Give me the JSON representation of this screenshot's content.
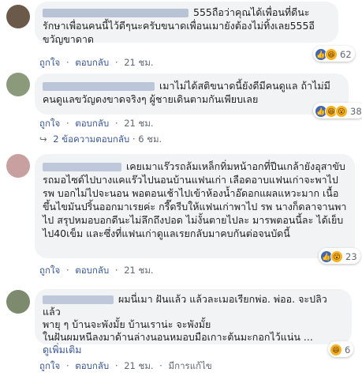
{
  "comments": [
    {
      "text_tail": "555ถือว่าคุณได้เพื่อนที่ดีนะรักษาเพื่อนคนนี้ไว้ดีๆนะครับขนาดเพื่อนเมายังต้องไม่ทิ้งเลย555อีขวัญขาดาด",
      "like_label": "ถูกใจ",
      "reply_label": "ตอบกลับ",
      "time": "21 ชม.",
      "reaction_count": "62"
    },
    {
      "text_tail": "เมาไม่ได้สติขนาดนี้ยังดีมีคนดูแล ถ้าไม่มีคนดูแลขวัญดงขาดจริงๆ ผู้ชายเดินตามกันเพียบเลย",
      "like_label": "ถูกใจ",
      "reply_label": "ตอบกลับ",
      "time": "21 ชม.",
      "reaction_count": "38"
    },
    {
      "text_tail": "เคยเมาแร๊วรถล้มเหล็กทิ่มหน้าอกที่ปีนเกล้ายังอุสาขับรถมอไซด์ไปบางแคแร๊วไปนอนบ้านแฟนเก่า เลือดอาบแฟนเก่าจะพาไปรพ บอกไม่ไปจะนอน พอตอนเช้าไปเข้าห้องน้ำอ๊ดอกแผลแหวะมาก เนื้อขึ้นไขมันปริ้นออกมาเรยค่ะ กรี๊ดรีบให้แฟนเก่าพาไป รพ นางก็ดลาจานพาไป สรุปหมอบอกดีนะไม่ลึกถึงปอด ไม่งั้นตายไปละ มารพตอนนี้ละ ได้เย็บไป40เข็ม และซึ่งที่แฟนเก่าดูแลเรยกลับมาคบกันต่อจนบัดนี้",
      "like_label": "ถูกใจ",
      "reply_label": "ตอบกลับ",
      "time": "21 ชม.",
      "reaction_count": "23"
    },
    {
      "text_tail": "ผมนี่เมา ฝันแล้ว แล้วละเมอเรียกพ่อ. พ่ออ. จะปลิวแล้ว",
      "line2": "พายุ ๆ บ้านจะพังมั้ย บ้านเราน่ะ จะพังมั้ย",
      "line3": "ในฝันผมหนีลงมาด้านล่างนอนหมอบมือเกาะต้นมะกอกไว้แน่น ...",
      "see_more": "ดูเพิ่มเติม",
      "like_label": "ถูกใจ",
      "reply_label": "ตอบกลับ",
      "time": "21 ชม.",
      "edited": "มีการแก้ไข",
      "reaction_count": "6"
    }
  ],
  "replies_link": {
    "label": "2 ข้อความตอบกลับ",
    "time": "6 ชม."
  },
  "colors": {
    "bubble": "#f2f3f5",
    "link": "#385898",
    "meta": "#606770",
    "like": "#4267b2",
    "haha": "#f7b125"
  }
}
